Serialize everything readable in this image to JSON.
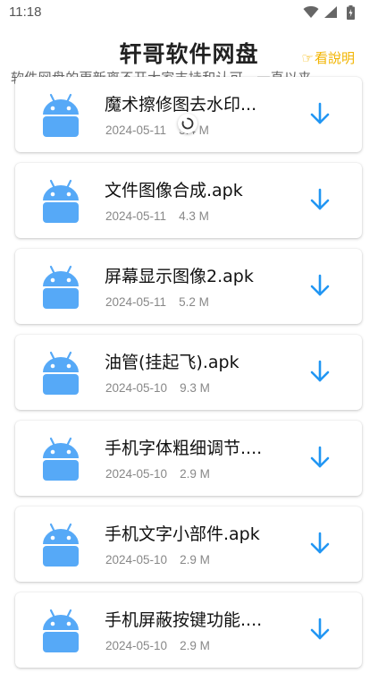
{
  "status_bar": {
    "time": "11:18"
  },
  "header": {
    "title": "轩哥软件网盘",
    "help_hand": "☞",
    "help_label": "看說明",
    "marquee": "软件网盘的更新离不开大家支持和认可，一直以来"
  },
  "files": [
    {
      "name": "魔术擦修图去水印...",
      "date": "2024-05-11",
      "size": "5.4 M"
    },
    {
      "name": "文件图像合成.apk",
      "date": "2024-05-11",
      "size": "4.3 M"
    },
    {
      "name": "屏幕显示图像2.apk",
      "date": "2024-05-11",
      "size": "5.2 M"
    },
    {
      "name": "油管(挂起飞).apk",
      "date": "2024-05-10",
      "size": "9.3 M"
    },
    {
      "name": "手机字体粗细调节....",
      "date": "2024-05-10",
      "size": "2.9 M"
    },
    {
      "name": "手机文字小部件.apk",
      "date": "2024-05-10",
      "size": "2.9 M"
    },
    {
      "name": "手机屏蔽按键功能....",
      "date": "2024-05-10",
      "size": "2.9 M"
    }
  ],
  "icons": {
    "file_icon": "android-icon",
    "download": "download-arrow-icon",
    "loading": "loading-spinner-icon"
  },
  "colors": {
    "android": "#56a9f7",
    "download": "#2196f3",
    "help_link": "#f2b400"
  }
}
